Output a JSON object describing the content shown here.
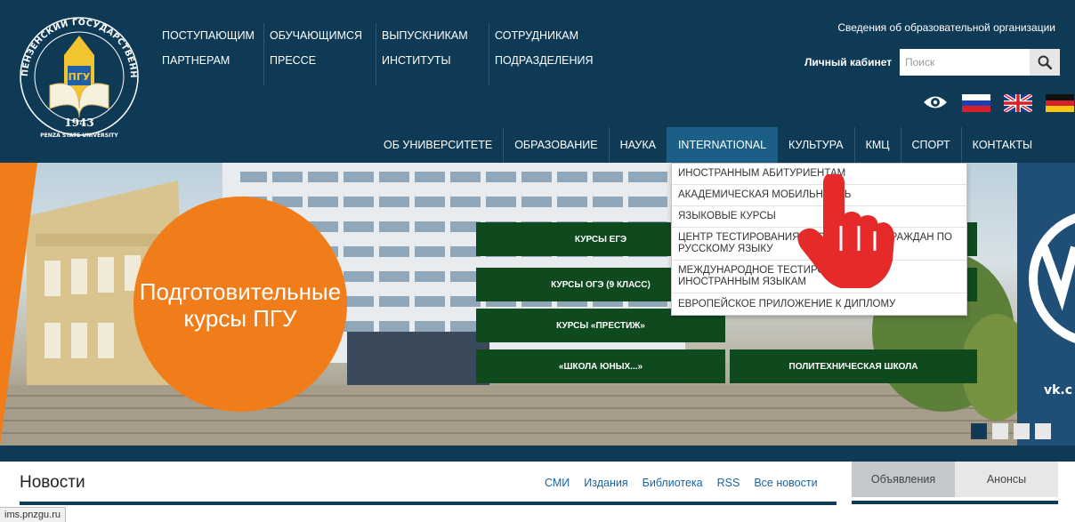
{
  "logo": {
    "ring_text": "ПЕНЗЕНСКИЙ ГОСУДАРСТВЕННЫЙ УНИВЕРСИТЕТ",
    "center_text": "ПГУ",
    "year": "1943",
    "sub_text": "PENZA STATE UNIVERSITY"
  },
  "header": {
    "toplinks": [
      [
        "ПОСТУПАЮЩИМ",
        "ПАРТНЕРАМ"
      ],
      [
        "ОБУЧАЮЩИМСЯ",
        "ПРЕССЕ"
      ],
      [
        "ВЫПУСКНИКАМ",
        "ИНСТИТУТЫ"
      ],
      [
        "СОТРУДНИКАМ",
        "ПОДРАЗДЕЛЕНИЯ"
      ]
    ],
    "svedeniya": "Сведения об образовательной организации",
    "cabinet": "Личный кабинет",
    "search_placeholder": "Поиск"
  },
  "nav": {
    "items": [
      "ОБ УНИВЕРСИТЕТЕ",
      "ОБРАЗОВАНИЕ",
      "НАУКА",
      "INTERNATIONAL",
      "КУЛЬТУРА",
      "КМЦ",
      "СПОРТ",
      "КОНТАКТЫ"
    ],
    "active_index": 3
  },
  "dropdown": {
    "items": [
      "ИНОСТРАННЫМ АБИТУРИЕНТАМ",
      "АКАДЕМИЧЕСКАЯ МОБИЛЬНОСТЬ",
      "ЯЗЫКОВЫЕ КУРСЫ",
      "ЦЕНТР ТЕСТИРОВАНИЯ ИНОСТРАННЫХ ГРАЖДАН ПО РУССКОМУ ЯЗЫКУ",
      "МЕЖДУНАРОДНОЕ ТЕСТИРОВАНИЕ ПО ИНОСТРАННЫМ ЯЗЫКАМ",
      "ЕВРОПЕЙСКОЕ ПРИЛОЖЕНИЕ К ДИПЛОМУ"
    ]
  },
  "hero": {
    "circle_text_1": "Подготовительные",
    "circle_text_2": "курсы ПГУ",
    "buttons": {
      "ege": "КУРСЫ ЕГЭ",
      "oge": "КУРСЫ ОГЭ (9 КЛАСС)",
      "prestige": "КУРСЫ «ПРЕСТИЖ»",
      "young": "«ШКОЛА ЮНЫХ...»",
      "poly": "ПОЛИТЕХНИЧЕСКАЯ ШКОЛА"
    },
    "vk_text": "vk.c"
  },
  "news": {
    "title": "Новости",
    "links": [
      "СМИ",
      "Издания",
      "Библиотека",
      "RSS",
      "Все новости"
    ],
    "tabs": [
      "Объявления",
      "Анонсы"
    ]
  },
  "status": {
    "url": "ims.pnzgu.ru"
  },
  "colors": {
    "header_bg": "#0e3a56",
    "orange": "#f07d1a",
    "green": "#0f4a1f",
    "link": "#1565a3",
    "hand_red": "#e52a2a"
  }
}
